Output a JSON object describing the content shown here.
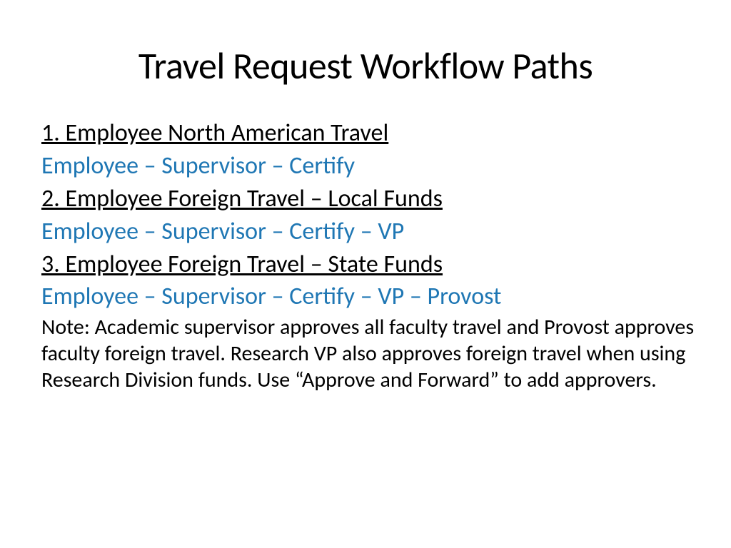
{
  "title": "Travel Request Workflow Paths",
  "sections": [
    {
      "heading": "1. Employee North American Travel",
      "path": "Employee – Supervisor – Certify"
    },
    {
      "heading": "2. Employee Foreign Travel – Local Funds",
      "path": "Employee – Supervisor – Certify – VP"
    },
    {
      "heading": "3. Employee Foreign Travel – State Funds",
      "path": "Employee – Supervisor – Certify – VP – Provost"
    }
  ],
  "note": "Note: Academic supervisor approves all faculty travel and Provost approves faculty foreign travel. Research VP also approves foreign travel when using  Research Division funds.  Use “Approve and Forward” to add approvers."
}
